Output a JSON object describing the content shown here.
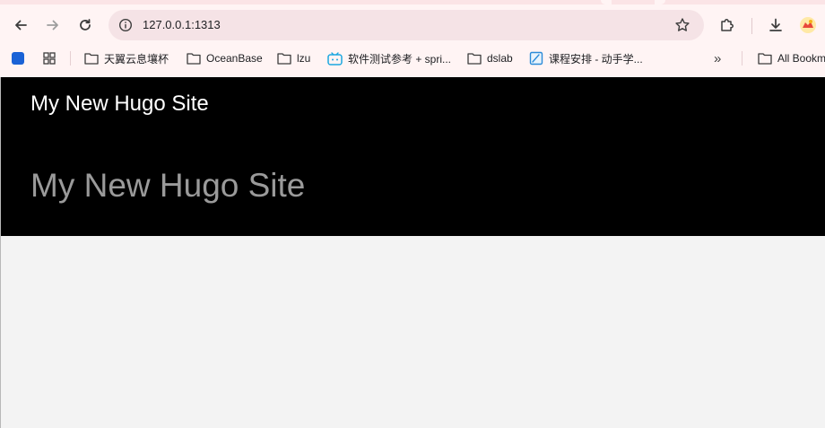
{
  "browser": {
    "address_bar": {
      "url": "127.0.0.1:1313"
    },
    "bookmarks": [
      {
        "label": "",
        "icon": "blue-square-icon"
      },
      {
        "label": "",
        "icon": "apps-grid-icon"
      },
      {
        "label": "天翼云息壤杯",
        "icon": "folder-icon"
      },
      {
        "label": "OceanBase",
        "icon": "folder-icon"
      },
      {
        "label": "lzu",
        "icon": "folder-icon"
      },
      {
        "label": "软件测试参考 + spri...",
        "icon": "bilibili-icon"
      },
      {
        "label": "dslab",
        "icon": "folder-icon"
      },
      {
        "label": "课程安排 - 动手学...",
        "icon": "notebook-icon"
      },
      {
        "label": "All Bookmarks",
        "icon": "folder-icon"
      }
    ]
  },
  "site": {
    "brand": "My New Hugo Site",
    "title": "My New Hugo Site"
  },
  "colors": {
    "chrome_bg": "#fff4f4",
    "omnibox_bg": "#f5e3e6",
    "header_bg": "#000000",
    "page_bg": "#f3f3f3",
    "accent_blue": "#1a73e8"
  }
}
